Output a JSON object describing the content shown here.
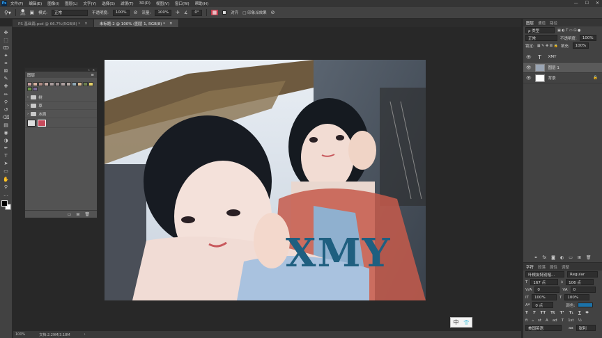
{
  "menubar": {
    "logo": "Ps",
    "items": [
      "文件(F)",
      "编辑(E)",
      "图像(I)",
      "图层(L)",
      "文字(Y)",
      "选择(S)",
      "滤镜(T)",
      "3D(D)",
      "视图(V)",
      "窗口(W)",
      "帮助(H)"
    ],
    "window_controls": [
      "—",
      "☐",
      "✕"
    ]
  },
  "optbar": {
    "brush_size": "245",
    "mode_label": "模式:",
    "mode_value": "正常",
    "opacity_label": "不透明度:",
    "opacity_value": "100%",
    "flow_label": "流量:",
    "flow_value": "100%",
    "angle_value": "0°",
    "align_label": "对齐",
    "sample_label": "□ 印象派效果"
  },
  "tabs": [
    {
      "label": "PS 基础篇.psd @ 66.7%(RGB/8) *",
      "close": "×",
      "active": false
    },
    {
      "label": "未标题-2 @ 100% (图层 1, RGB/8) *",
      "close": "×",
      "active": true
    }
  ],
  "toolbar": {
    "icons": [
      "move-icon",
      "marquee-icon",
      "lasso-icon",
      "magic-wand-icon",
      "crop-icon",
      "frame-icon",
      "eyedropper-icon",
      "healing-icon",
      "brush-icon",
      "clone-stamp-icon",
      "history-brush-icon",
      "eraser-icon",
      "gradient-icon",
      "blur-icon",
      "dodge-icon",
      "pen-icon",
      "type-icon",
      "path-select-icon",
      "rectangle-icon",
      "hand-icon",
      "zoom-icon",
      "more-icon"
    ],
    "glyphs": [
      "✥",
      "⬚",
      "ↀ",
      "✦",
      "⌗",
      "⊠",
      "✎",
      "✚",
      "✏",
      "⚲",
      "↺",
      "⌫",
      "▤",
      "◉",
      "◑",
      "✒",
      "T",
      "➤",
      "▭",
      "✋",
      "⚲",
      "…"
    ],
    "fg_color": "#000000",
    "bg_color": "#ffffff"
  },
  "canvas": {
    "overlay_text": "XMY",
    "overlay_color": "#1f5f80"
  },
  "float_panel": {
    "title": "图层",
    "collapse": "«",
    "close": "✕",
    "folders": [
      "树",
      "草",
      "水面"
    ],
    "chip_colors": [
      "#c9a1a1",
      "#d6b2a2",
      "#b08d86",
      "#c2a8a1",
      "#a89b9b",
      "#9b8e8e",
      "#ada0a0",
      "#b3a7a2",
      "#8fa8b5",
      "#d7b88d",
      "#6b7f4f",
      "#e7d36a",
      "#6d9a4a",
      "#7d6b9c"
    ],
    "footer_icons": [
      "▭",
      "⊞",
      "🗑"
    ]
  },
  "statusbar": {
    "zoom": "100%",
    "doc": "文档:2.29M/3.18M",
    "arrow": "›"
  },
  "ime": {
    "lang": "中",
    "shirt": "👕"
  },
  "rdock": {
    "layer_tabs": [
      "图层",
      "通道",
      "路径"
    ],
    "kind_label": "ρ 类型",
    "blend": "正常",
    "opacity_label": "不透明度:",
    "opacity_value": "100%",
    "lock_label": "锁定:",
    "fill_label": "填充:",
    "fill_value": "100%",
    "layers": [
      {
        "name": "XMY",
        "type": "T",
        "selected": false
      },
      {
        "name": "图层 1",
        "type": "img",
        "selected": true
      },
      {
        "name": "背景",
        "type": "bg",
        "selected": false
      }
    ],
    "char_tabs": [
      "字符",
      "段落",
      "属性",
      "调整"
    ],
    "font_name": "叶根友特别楷...",
    "font_style": "Regular",
    "font_size": "167 点",
    "leading": "106 点",
    "tracking_label": "V/A",
    "tracking": "0",
    "kern_value": "0",
    "scale_v": "100%",
    "scale_h": "100%",
    "baseline": "0 点",
    "color_label": "颜色:",
    "text_color": "#1c72a8",
    "style_buttons": [
      "T",
      "T",
      "TT",
      "Tt",
      "T¹",
      "T₁",
      "T",
      "T"
    ],
    "extra_buttons": [
      "fi",
      "ℴ",
      "st",
      "A",
      "ad",
      "T",
      "1st",
      "½"
    ],
    "language": "美国英语",
    "aa_label": "aa",
    "aa_value": "锐利"
  }
}
